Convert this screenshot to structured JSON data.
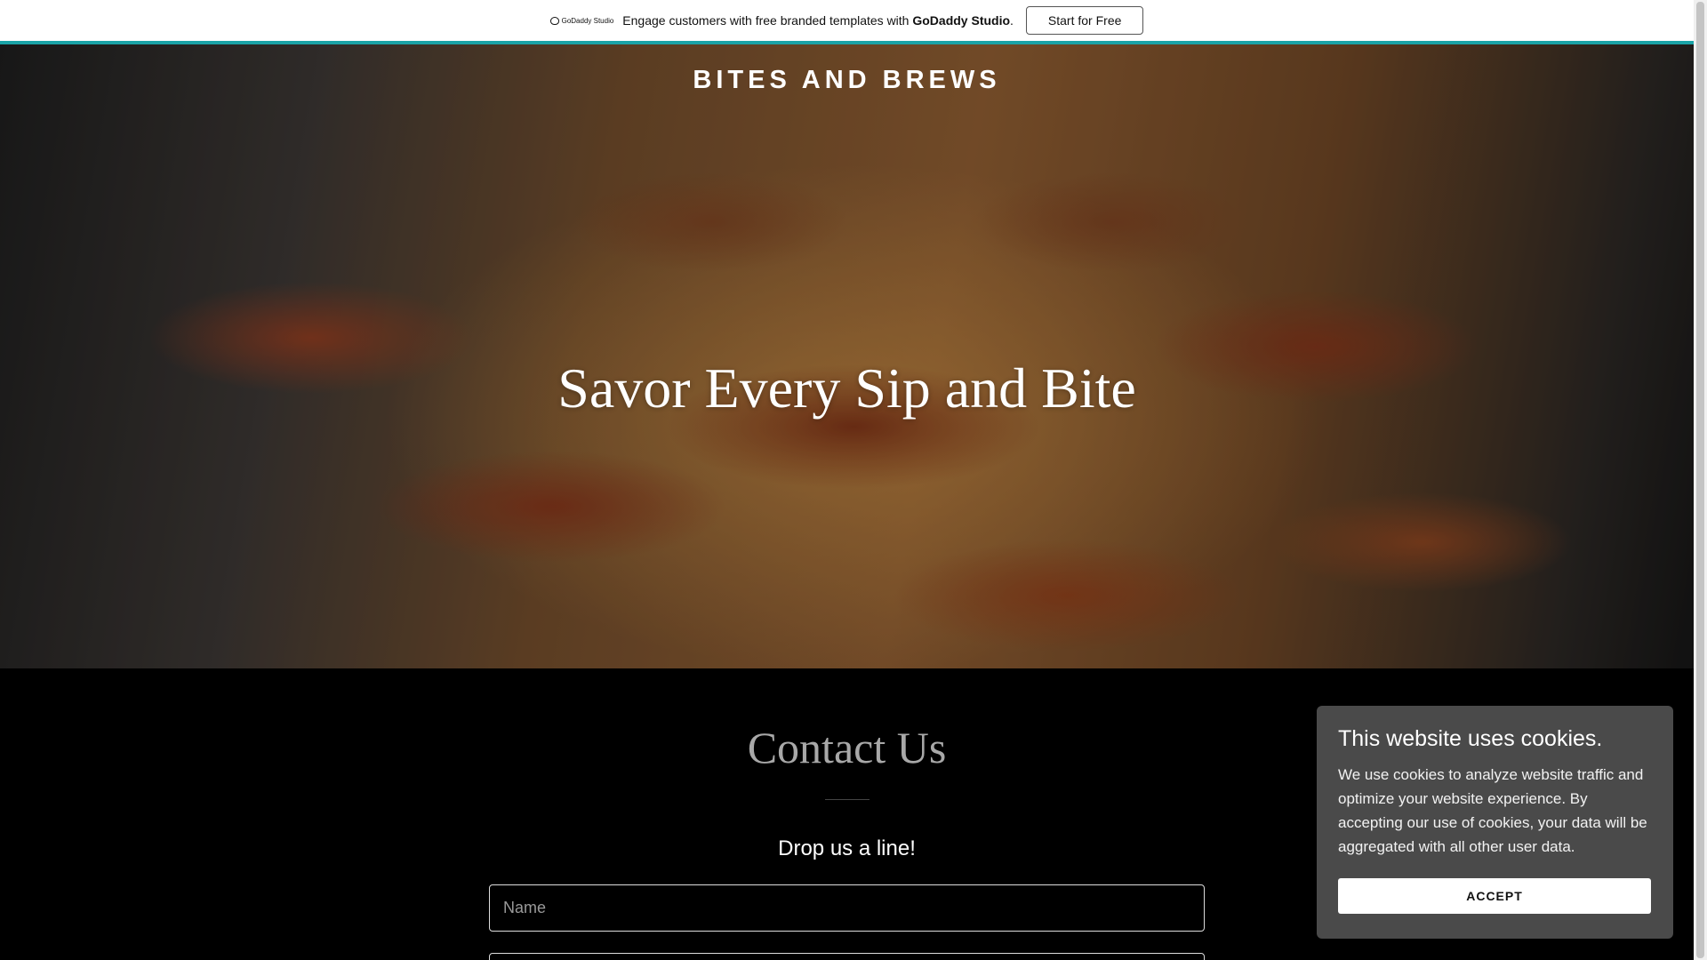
{
  "promo": {
    "logo_text": "GoDaddy Studio",
    "message_prefix": "Engage customers with free branded templates with ",
    "message_brand": "GoDaddy Studio",
    "message_suffix": ".",
    "cta_label": "Start for Free",
    "accent_color": "#1aa3a7"
  },
  "hero": {
    "brand": "BITES AND BREWS",
    "headline": "Savor Every Sip and Bite"
  },
  "contact": {
    "title": "Contact Us",
    "subtitle": "Drop us a line!",
    "name_placeholder": "Name"
  },
  "cookie": {
    "title": "This website uses cookies.",
    "body": "We use cookies to analyze website traffic and optimize your website experience. By accepting our use of cookies, your data will be aggregated with all other user data.",
    "accept_label": "ACCEPT"
  }
}
